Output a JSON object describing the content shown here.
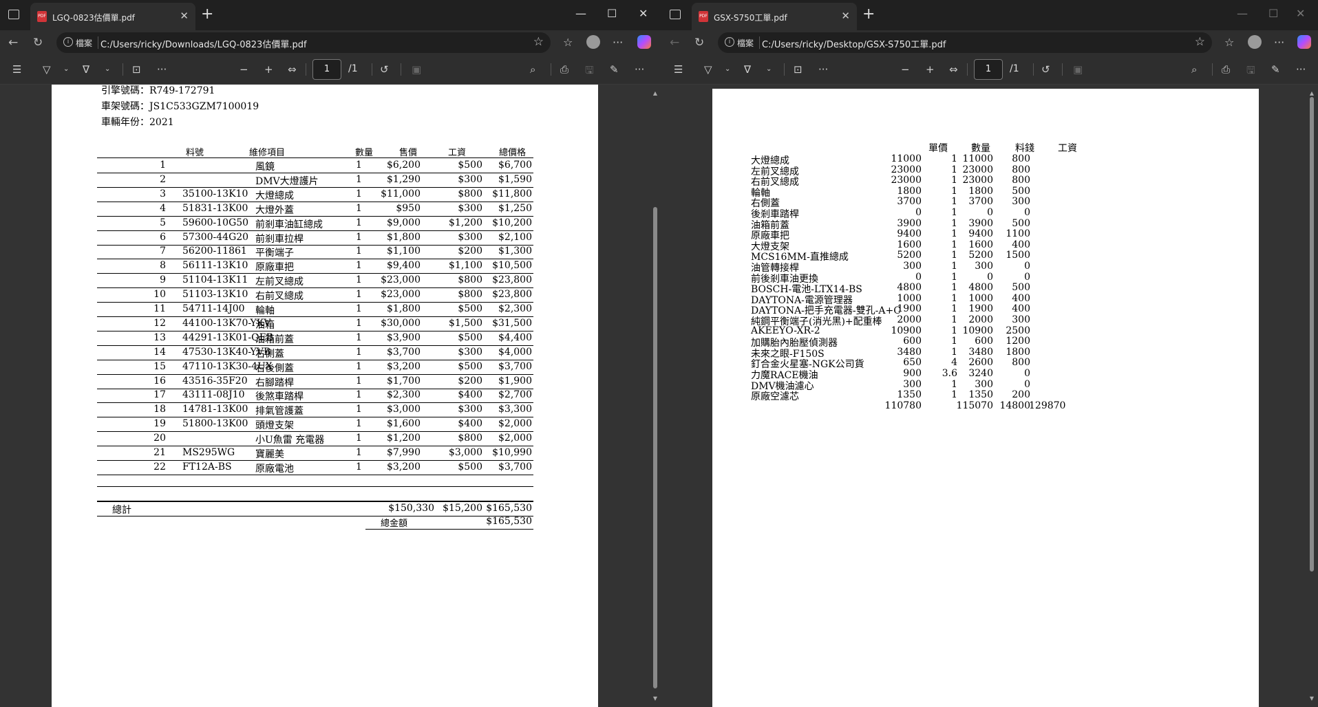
{
  "left_window": {
    "tab_title": "LGQ-0823估價單.pdf",
    "address_label": "檔案",
    "url": "C:/Users/ricky/Downloads/LGQ-0823估價單.pdf",
    "page_number": "1",
    "page_total": "/1",
    "document": {
      "info": [
        "引擎號碼：R749-172791",
        "車架號碼：JS1C533GZM7100019",
        "車輛年份：2021"
      ],
      "headers": {
        "part_no": "料號",
        "item": "維修項目",
        "qty": "數量",
        "price": "售價",
        "labor": "工資",
        "total": "總價格"
      },
      "rows": [
        {
          "no": "1",
          "part": "",
          "item": "風鏡",
          "qty": "1",
          "price": "$6,200",
          "labor": "$500",
          "total": "$6,700"
        },
        {
          "no": "2",
          "part": "",
          "item": "DMV大燈護片",
          "qty": "1",
          "price": "$1,290",
          "labor": "$300",
          "total": "$1,590"
        },
        {
          "no": "3",
          "part": "35100-13K10",
          "item": "大燈總成",
          "qty": "1",
          "price": "$11,000",
          "labor": "$800",
          "total": "$11,800"
        },
        {
          "no": "4",
          "part": "51831-13K00",
          "item": "大燈外蓋",
          "qty": "1",
          "price": "$950",
          "labor": "$300",
          "total": "$1,250"
        },
        {
          "no": "5",
          "part": "59600-10G50",
          "item": "前剎車油缸總成",
          "qty": "1",
          "price": "$9,000",
          "labor": "$1,200",
          "total": "$10,200"
        },
        {
          "no": "6",
          "part": "57300-44G20",
          "item": "前剎車拉桿",
          "qty": "1",
          "price": "$1,800",
          "labor": "$300",
          "total": "$2,100"
        },
        {
          "no": "7",
          "part": "56200-11861",
          "item": "平衡端子",
          "qty": "1",
          "price": "$1,100",
          "labor": "$200",
          "total": "$1,300"
        },
        {
          "no": "8",
          "part": "56111-13K10",
          "item": "原廠車把",
          "qty": "1",
          "price": "$9,400",
          "labor": "$1,100",
          "total": "$10,500"
        },
        {
          "no": "9",
          "part": "51104-13K11",
          "item": "左前叉總成",
          "qty": "1",
          "price": "$23,000",
          "labor": "$800",
          "total": "$23,800"
        },
        {
          "no": "10",
          "part": "51103-13K10",
          "item": "右前叉總成",
          "qty": "1",
          "price": "$23,000",
          "labor": "$800",
          "total": "$23,800"
        },
        {
          "no": "11",
          "part": "54711-14J00",
          "item": "輪軸",
          "qty": "1",
          "price": "$1,800",
          "labor": "$500",
          "total": "$2,300"
        },
        {
          "no": "12",
          "part": "44100-13K70-YKV",
          "item": "油箱",
          "qty": "1",
          "price": "$30,000",
          "labor": "$1,500",
          "total": "$31,500"
        },
        {
          "no": "13",
          "part": "44291-13K01-QEB",
          "item": "油箱前蓋",
          "qty": "1",
          "price": "$3,900",
          "labor": "$500",
          "total": "$4,400"
        },
        {
          "no": "14",
          "part": "47530-13K40-YVB",
          "item": "右側蓋",
          "qty": "1",
          "price": "$3,700",
          "labor": "$300",
          "total": "$4,000"
        },
        {
          "no": "15",
          "part": "47110-13K30-4UX",
          "item": "右後側蓋",
          "qty": "1",
          "price": "$3,200",
          "labor": "$500",
          "total": "$3,700"
        },
        {
          "no": "16",
          "part": "43516-35F20",
          "item": "右腳踏桿",
          "qty": "1",
          "price": "$1,700",
          "labor": "$200",
          "total": "$1,900"
        },
        {
          "no": "17",
          "part": "43111-08J10",
          "item": "後煞車踏桿",
          "qty": "1",
          "price": "$2,300",
          "labor": "$400",
          "total": "$2,700"
        },
        {
          "no": "18",
          "part": "14781-13K00",
          "item": "排氣管護蓋",
          "qty": "1",
          "price": "$3,000",
          "labor": "$300",
          "total": "$3,300"
        },
        {
          "no": "19",
          "part": "51800-13K00",
          "item": "頭燈支架",
          "qty": "1",
          "price": "$1,600",
          "labor": "$400",
          "total": "$2,000"
        },
        {
          "no": "20",
          "part": "",
          "item": "小U魚雷 充電器",
          "qty": "1",
          "price": "$1,200",
          "labor": "$800",
          "total": "$2,000"
        },
        {
          "no": "21",
          "part": "MS295WG",
          "item": "寶麗美",
          "qty": "1",
          "price": "$7,990",
          "labor": "$3,000",
          "total": "$10,990"
        },
        {
          "no": "22",
          "part": "FT12A-BS",
          "item": "原廠電池",
          "qty": "1",
          "price": "$3,200",
          "labor": "$500",
          "total": "$3,700"
        }
      ],
      "summary": {
        "label": "總計",
        "price": "$150,330",
        "labor": "$15,200",
        "total": "$165,530",
        "grand_label": "總金額",
        "grand_total": "$165,530"
      }
    }
  },
  "right_window": {
    "tab_title": "GSX-S750工單.pdf",
    "address_label": "檔案",
    "url": "C:/Users/ricky/Desktop/GSX-S750工單.pdf",
    "page_number": "1",
    "page_total": "/1",
    "document": {
      "headers": {
        "unit_price": "單價",
        "qty": "數量",
        "material": "料錢",
        "labor": "工資"
      },
      "rows": [
        {
          "item": "大燈總成",
          "unit": "11000",
          "qty": "1",
          "material": "11000",
          "labor": "800"
        },
        {
          "item": "左前叉總成",
          "unit": "23000",
          "qty": "1",
          "material": "23000",
          "labor": "800"
        },
        {
          "item": "右前叉總成",
          "unit": "23000",
          "qty": "1",
          "material": "23000",
          "labor": "800"
        },
        {
          "item": "輪軸",
          "unit": "1800",
          "qty": "1",
          "material": "1800",
          "labor": "500"
        },
        {
          "item": "右側蓋",
          "unit": "3700",
          "qty": "1",
          "material": "3700",
          "labor": "300"
        },
        {
          "item": "後剎車踏桿",
          "unit": "0",
          "qty": "1",
          "material": "0",
          "labor": "0"
        },
        {
          "item": "油箱前蓋",
          "unit": "3900",
          "qty": "1",
          "material": "3900",
          "labor": "500"
        },
        {
          "item": "原廠車把",
          "unit": "9400",
          "qty": "1",
          "material": "9400",
          "labor": "1100"
        },
        {
          "item": "大燈支架",
          "unit": "1600",
          "qty": "1",
          "material": "1600",
          "labor": "400"
        },
        {
          "item": "MCS16MM-直推總成",
          "unit": "5200",
          "qty": "1",
          "material": "5200",
          "labor": "1500"
        },
        {
          "item": "油管轉接桿",
          "unit": "300",
          "qty": "1",
          "material": "300",
          "labor": "0"
        },
        {
          "item": "前後剎車油更換",
          "unit": "0",
          "qty": "1",
          "material": "0",
          "labor": "0"
        },
        {
          "item": "BOSCH-電池-LTX14-BS",
          "unit": "4800",
          "qty": "1",
          "material": "4800",
          "labor": "500"
        },
        {
          "item": "DAYTONA-電源管理器",
          "unit": "1000",
          "qty": "1",
          "material": "1000",
          "labor": "400"
        },
        {
          "item": "DAYTONA-把手充電器-雙孔-A+C",
          "unit": "1900",
          "qty": "1",
          "material": "1900",
          "labor": "400"
        },
        {
          "item": "純鋼平衡端子(消光黑)+配重棒",
          "unit": "2000",
          "qty": "1",
          "material": "2000",
          "labor": "300"
        },
        {
          "item": "AKEEYO-XR-2",
          "unit": "10900",
          "qty": "1",
          "material": "10900",
          "labor": "2500"
        },
        {
          "item": "加購胎內胎壓偵測器",
          "unit": "600",
          "qty": "1",
          "material": "600",
          "labor": "1200"
        },
        {
          "item": "未來之眼-F150S",
          "unit": "3480",
          "qty": "1",
          "material": "3480",
          "labor": "1800"
        },
        {
          "item": "釘合金火星塞-NGK公司貨",
          "unit": "650",
          "qty": "4",
          "material": "2600",
          "labor": "800"
        },
        {
          "item": "力魔RACE機油",
          "unit": "900",
          "qty": "3.6",
          "material": "3240",
          "labor": "0"
        },
        {
          "item": "DMV機油濾心",
          "unit": "300",
          "qty": "1",
          "material": "300",
          "labor": "0"
        },
        {
          "item": "原廠空濾芯",
          "unit": "1350",
          "qty": "1",
          "material": "1350",
          "labor": "200"
        }
      ],
      "totals": {
        "unit": "110780",
        "material": "115070",
        "labor": "14800",
        "grand": "129870"
      }
    }
  },
  "icons": [
    "sidebar-icon",
    "pdf-icon",
    "close-icon",
    "plus-icon",
    "minimize-icon",
    "maximize-icon",
    "back-icon",
    "refresh-icon",
    "info-icon",
    "star-icon",
    "favorites-icon",
    "profile-icon",
    "more-icon",
    "copilot-icon",
    "contents-icon",
    "highlight-icon",
    "draw-icon",
    "text-icon",
    "zoom-out-icon",
    "zoom-in-icon",
    "fit-icon",
    "rotate-icon",
    "two-page-icon",
    "search-icon",
    "print-icon",
    "save-icon",
    "save-as-icon"
  ]
}
